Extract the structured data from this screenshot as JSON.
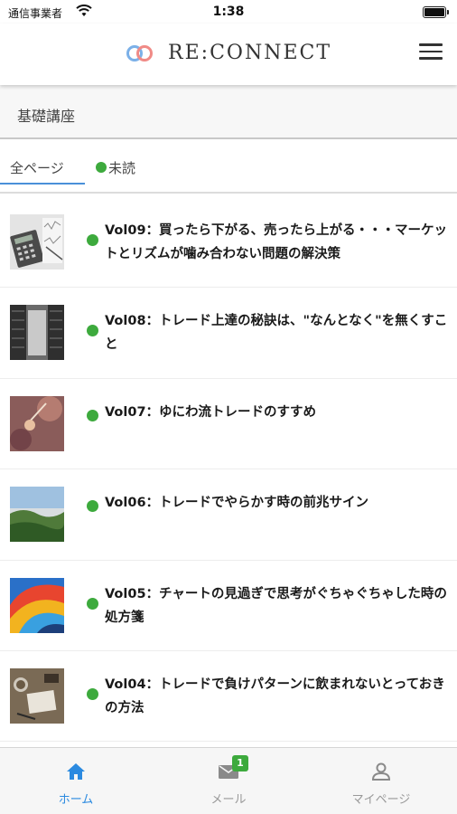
{
  "status_bar": {
    "carrier": "通信事業者",
    "time": "1:38"
  },
  "header": {
    "logo_text": "RE:CONNECT",
    "menu_icon": "hamburger-menu-icon"
  },
  "category": {
    "label": "基礎講座"
  },
  "tabs": [
    {
      "label": "全ページ",
      "selected": true
    },
    {
      "label": "未読",
      "selected": false
    }
  ],
  "articles": [
    {
      "title": "Vol09：買ったら下がる、売ったら上がる・・・マーケットとリズムが噛み合わない問題の解決策",
      "unread": true
    },
    {
      "title": "Vol08：トレード上達の秘訣は、\"なんとなく\"を無くすこと",
      "unread": true
    },
    {
      "title": "Vol07：ゆにわ流トレードのすすめ",
      "unread": true
    },
    {
      "title": "Vol06：トレードでやらかす時の前兆サイン",
      "unread": true
    },
    {
      "title": "Vol05：チャートの見過ぎで思考がぐちゃぐちゃした時の処方箋",
      "unread": true
    },
    {
      "title": "Vol04：トレードで負けパターンに飲まれないとっておきの方法",
      "unread": true
    }
  ],
  "bottom_nav": {
    "home": {
      "label": "ホーム",
      "icon": "home-icon"
    },
    "mail": {
      "label": "メール",
      "icon": "mail-icon",
      "badge": "1"
    },
    "mypage": {
      "label": "マイページ",
      "icon": "person-icon"
    }
  },
  "colors": {
    "accent": "#2b8ae0",
    "unread_dot": "#3daa3d",
    "tab_underline": "#4a90d9"
  }
}
